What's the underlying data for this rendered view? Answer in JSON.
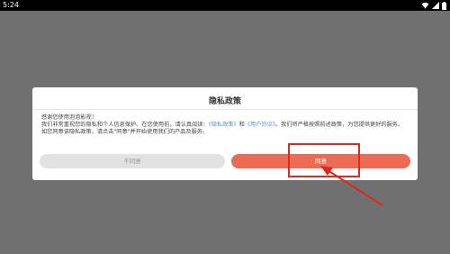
{
  "status_bar": {
    "time": "5:24",
    "icons": [
      "wifi-icon",
      "signal-icon",
      "battery-icon"
    ]
  },
  "dialog": {
    "title": "隐私政策",
    "greeting": "感谢您使用泡泡影视！",
    "body_part1": "我们非常重视您的隐私和个人信息保护。在您使用前，请认真阅读：",
    "privacy_link": "《隐私政策》",
    "connector": "和",
    "user_agreement_link": "《用户协议》",
    "body_part2": "。我们将严格按照前述政策，为您提供更好的服务。如您同意该隐私政策，请点击\"同意\"并开始使用我们的产品及服务。",
    "disagree_label": "不同意",
    "agree_label": "同意"
  },
  "colors": {
    "agree_button": "#ec6b55",
    "disagree_button": "#e2e2e2",
    "link": "#5b8fd6",
    "annotation": "#e0271b"
  }
}
